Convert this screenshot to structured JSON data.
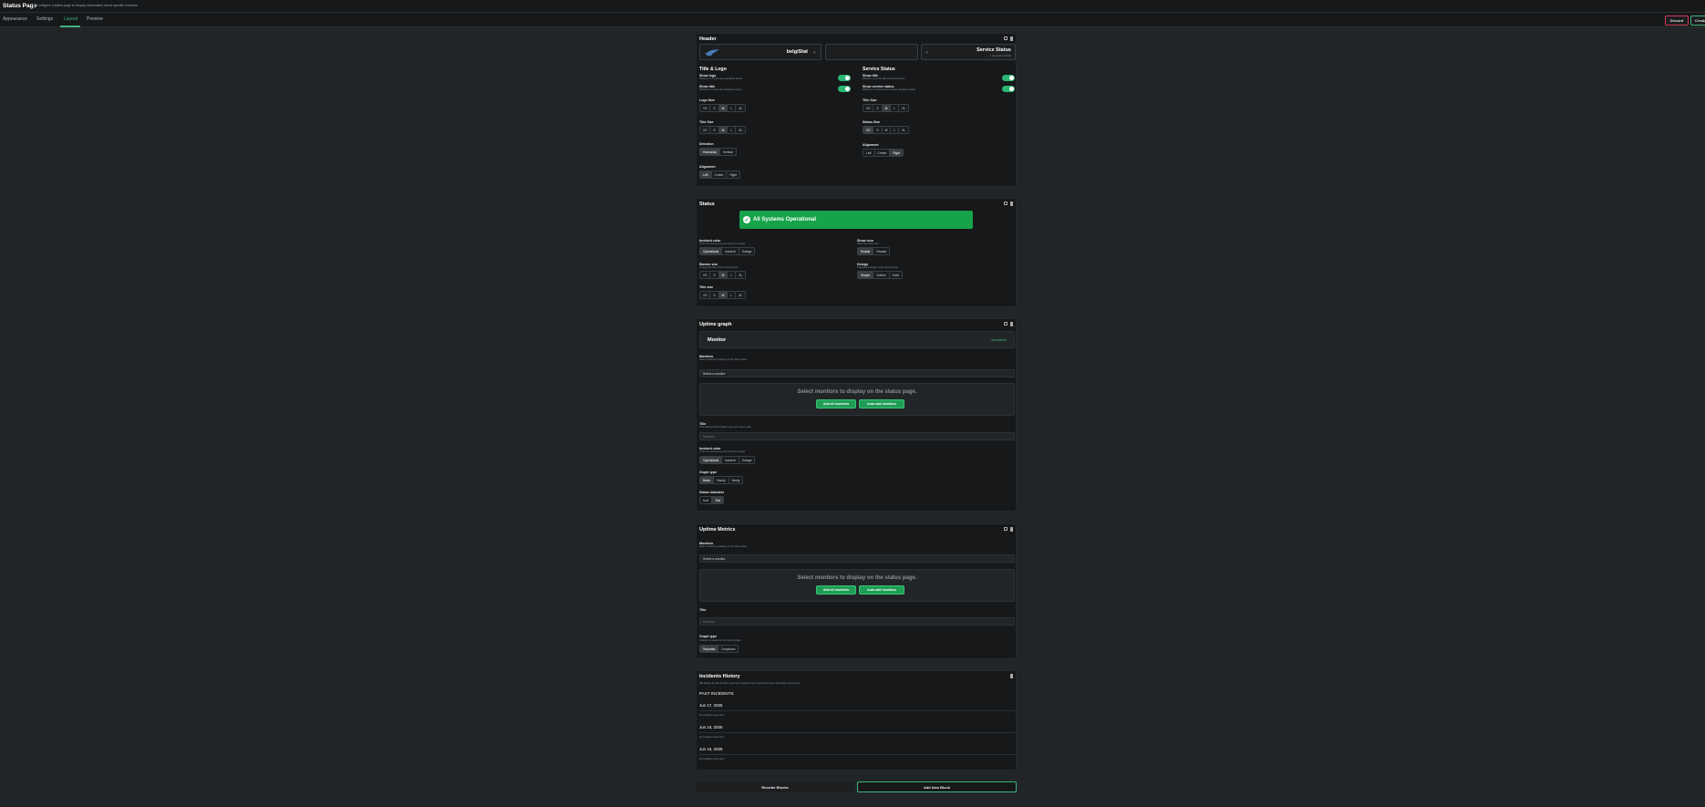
{
  "app": {
    "title": "Status Page",
    "description": "Configure a status page to display information about specific monitors"
  },
  "tabs": [
    "Appearance",
    "Settings",
    "Layout",
    "Preview"
  ],
  "actions": {
    "discard": "Discard",
    "create": "Create"
  },
  "header_card": {
    "title": "Header",
    "logo_text": "belgiStat",
    "service_status_title": "Service Status",
    "service_status_sub": "Last check: 0:00:00",
    "title_logo": {
      "heading": "Title & Logo",
      "show_logo": {
        "label": "Show logo",
        "sub": "Whether or not the logo should be shown"
      },
      "show_title": {
        "label": "Show title",
        "sub": "Whether or not the title should be shown"
      },
      "logo_size": {
        "label": "Logo Size",
        "options": [
          "XS",
          "S",
          "M",
          "L",
          "XL"
        ],
        "selected": "M"
      },
      "title_size": {
        "label": "Title Size",
        "options": [
          "XS",
          "S",
          "M",
          "L",
          "XL"
        ],
        "selected": "M"
      },
      "direction": {
        "label": "Direction",
        "options": [
          "Horizontal",
          "Vertical"
        ],
        "selected": "Horizontal"
      },
      "alignment": {
        "label": "Alignment",
        "options": [
          "Left",
          "Center",
          "Right"
        ],
        "selected": "Left"
      }
    },
    "service_status": {
      "heading": "Service Status",
      "show_title": {
        "label": "Show title",
        "sub": "Whether or not the title should be shown"
      },
      "show_service_status": {
        "label": "Show service status",
        "sub": "Whether or not the service status should be shown"
      },
      "title_size": {
        "label": "Title Size",
        "options": [
          "XS",
          "S",
          "M",
          "L",
          "XL"
        ],
        "selected": "M"
      },
      "status_size": {
        "label": "Status Size",
        "options": [
          "XS",
          "S",
          "M",
          "L",
          "XL"
        ],
        "selected": "XS"
      },
      "alignment": {
        "label": "Alignment",
        "options": [
          "Left",
          "Center",
          "Right"
        ],
        "selected": "Right"
      }
    }
  },
  "status_card": {
    "title": "Status",
    "banner_text": "All Systems Operational",
    "banner_color": "#16a34a",
    "incident_color": {
      "label": "Incident color",
      "sub": "This is for testing only and will not be saved",
      "options": [
        "Operational",
        "Incident",
        "Outage"
      ],
      "selected": "Operational"
    },
    "banner_size": {
      "label": "Banner size",
      "sub": "Change the size of the status banner",
      "options": [
        "XS",
        "S",
        "M",
        "L",
        "XL"
      ],
      "selected": "M"
    },
    "title_size": {
      "label": "Title size",
      "options": [
        "XS",
        "S",
        "M",
        "L",
        "XL"
      ],
      "selected": "M"
    },
    "show_icon": {
      "label": "Show icon",
      "sub": "Show the status icon",
      "options": [
        "Enable",
        "Disable"
      ],
      "selected": "Enable"
    },
    "design": {
      "label": "Design",
      "sub": "Change the design of the status banner",
      "options": [
        "Simple",
        "Outline",
        "Solid"
      ],
      "selected": "Simple"
    }
  },
  "uptime_graph_card": {
    "title": "Uptime graph",
    "monitor_name": "Monitor",
    "monitor_status": "Operational",
    "monitors": {
      "label": "Monitors",
      "sub": "Select monitors to display on the status block",
      "placeholder": "Select a monitor"
    },
    "empty_text": "Select monitors to display on the status page.",
    "add_all": "Add all monitors",
    "auto_add": "Auto add monitors",
    "title_field": {
      "label": "Title",
      "sub": "This section will be hidden if you don't want a title",
      "placeholder": "Monitors"
    },
    "incident_color": {
      "label": "Incident color",
      "sub": "This is for testing only and will not be saved",
      "options": [
        "Operational",
        "Incident",
        "Outage"
      ],
      "selected": "Operational"
    },
    "graph_type": {
      "label": "Graph type",
      "options": [
        "Basic",
        "Hourly",
        "Nerdy"
      ],
      "selected": "Basic"
    },
    "status_indicator": {
      "label": "Status indicator",
      "options": [
        "Icon",
        "Text"
      ],
      "selected": "Text"
    }
  },
  "uptime_metrics_card": {
    "title": "Uptime Metrics",
    "monitors": {
      "label": "Monitors",
      "sub": "Select monitors to display on the status block",
      "placeholder": "Select a monitor"
    },
    "empty_text": "Select monitors to display on the status page.",
    "add_all": "Add all monitors",
    "auto_add": "Auto add monitors",
    "title_field": {
      "label": "Title",
      "placeholder": "Monitors"
    },
    "graph_type": {
      "label": "Graph type",
      "sub": "Change the layout for the metrics graph",
      "options": [
        "Separate",
        "Dropdown"
      ],
      "selected": "Separate"
    }
  },
  "incidents_card": {
    "title": "Incidents History",
    "sub": "Will display the last 15 days, and if any incidents have occurred it'll show information about them",
    "past_label": "PAST INCIDENTS",
    "days": [
      {
        "date": "Jun 17, 2025",
        "note": "No incidents reported"
      },
      {
        "date": "Jun 16, 2025",
        "note": "No incidents reported"
      },
      {
        "date": "Jun 15, 2025",
        "note": "No incidents reported"
      }
    ]
  },
  "footer": {
    "reorder": "Reorder Blocks",
    "add_block": "Add New Block"
  }
}
